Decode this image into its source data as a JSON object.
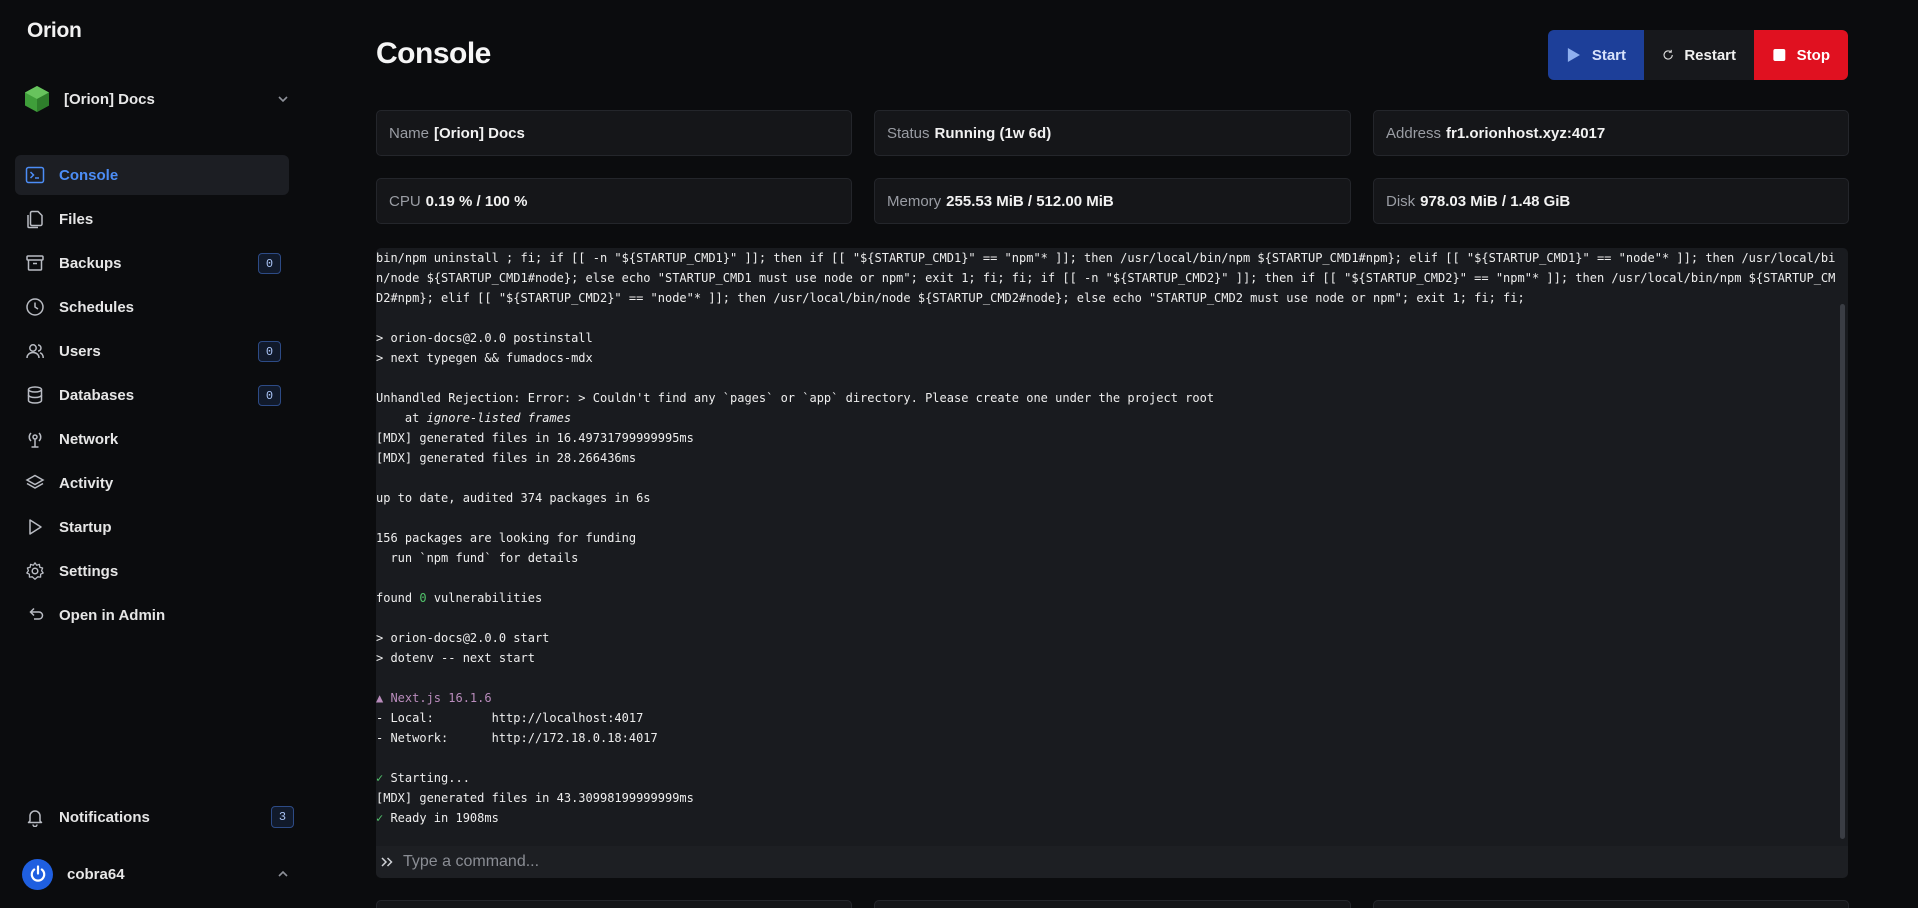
{
  "app": {
    "brand": "Orion"
  },
  "server": {
    "name": "[Orion] Docs"
  },
  "nav": {
    "items": [
      {
        "label": "Console",
        "icon": "terminal-icon",
        "active": true
      },
      {
        "label": "Files",
        "icon": "files-icon"
      },
      {
        "label": "Backups",
        "icon": "archive-icon",
        "badge": "0"
      },
      {
        "label": "Schedules",
        "icon": "clock-icon"
      },
      {
        "label": "Users",
        "icon": "users-icon",
        "badge": "0"
      },
      {
        "label": "Databases",
        "icon": "database-icon",
        "badge": "0"
      },
      {
        "label": "Network",
        "icon": "network-icon"
      },
      {
        "label": "Activity",
        "icon": "layers-icon"
      },
      {
        "label": "Startup",
        "icon": "play-icon"
      },
      {
        "label": "Settings",
        "icon": "gear-icon"
      },
      {
        "label": "Open in Admin",
        "icon": "return-icon"
      }
    ]
  },
  "notifications": {
    "label": "Notifications",
    "badge": "3"
  },
  "user": {
    "name": "cobra64"
  },
  "page": {
    "title": "Console"
  },
  "actions": {
    "start": "Start",
    "restart": "Restart",
    "stop": "Stop"
  },
  "stats": {
    "name": {
      "label": "Name",
      "value": "[Orion] Docs"
    },
    "status": {
      "label": "Status",
      "value": "Running (1w 6d)"
    },
    "address": {
      "label": "Address",
      "value": "fr1.orionhost.xyz:4017"
    },
    "cpu": {
      "label": "CPU",
      "value": "0.19 % / 100 %"
    },
    "memory": {
      "label": "Memory",
      "value": "255.53 MiB / 512.00 MiB"
    },
    "disk": {
      "label": "Disk",
      "value": "978.03 MiB / 1.48 GiB"
    }
  },
  "console": {
    "lines": [
      "bin/npm uninstall ; fi; if [[ -n \"${STARTUP_CMD1}\" ]]; then if [[ \"${STARTUP_CMD1}\" == \"npm\"* ]]; then /usr/local/bin/npm ${STARTUP_CMD1#npm}; elif [[ \"${STARTUP_CMD1}\" == \"node\"* ]]; then /usr/local/bin/node ${STARTUP_CMD1#node}; else echo \"STARTUP_CMD1 must use node or npm\"; exit 1; fi; fi; if [[ -n \"${STARTUP_CMD2}\" ]]; then if [[ \"${STARTUP_CMD2}\" == \"npm\"* ]]; then /usr/local/bin/npm ${STARTUP_CMD2#npm}; elif [[ \"${STARTUP_CMD2}\" == \"node\"* ]]; then /usr/local/bin/node ${STARTUP_CMD2#node}; else echo \"STARTUP_CMD2 must use node or npm\"; exit 1; fi; fi;",
      "",
      "> orion-docs@2.0.0 postinstall",
      "> next typegen && fumadocs-mdx",
      "",
      "Unhandled Rejection: Error: > Couldn't find any `pages` or `app` directory. Please create one under the project root",
      "    at ",
      "ignore-listed frames",
      "[MDX] generated files in 16.49731799999995ms",
      "[MDX] generated files in 28.266436ms",
      "",
      "up to date, audited 374 packages in 6s",
      "",
      "156 packages are looking for funding",
      "  run `npm fund` for details",
      "",
      "found ",
      "0",
      " vulnerabilities",
      "",
      "> orion-docs@2.0.0 start",
      "> dotenv -- next start",
      "",
      "▲ Next.js 16.1.6",
      "- Local:        http://localhost:4017",
      "- Network:      http://172.18.0.18:4017",
      "",
      "✓",
      " Starting...",
      "[MDX] generated files in 43.30998199999999ms",
      "✓",
      " Ready in 1908ms",
      "",
      "_"
    ]
  },
  "command": {
    "placeholder": "Type a command..."
  },
  "colors": {
    "accent": "#4c8df6",
    "start": "#1d3f99",
    "stop": "#e01120",
    "success": "#52c46b"
  }
}
